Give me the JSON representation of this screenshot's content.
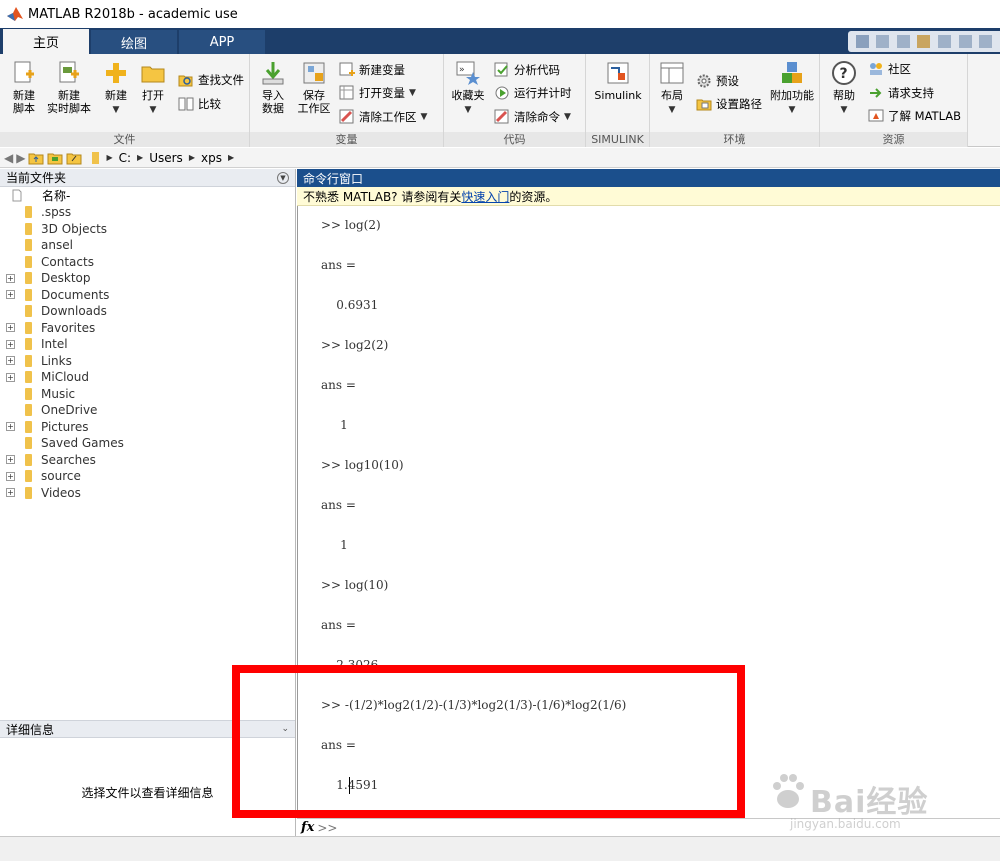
{
  "window": {
    "title": "MATLAB R2018b - academic use"
  },
  "tabs": [
    {
      "label": "主页"
    },
    {
      "label": "绘图"
    },
    {
      "label": "APP"
    }
  ],
  "ribbon": {
    "file": {
      "label": "文件",
      "new_script": "新建\n脚本",
      "new_live_script": "新建\n实时脚本",
      "new": "新建",
      "open": "打开",
      "find_files": "查找文件",
      "compare": "比较"
    },
    "variable": {
      "label": "变量",
      "import_data": "导入\n数据",
      "save_workspace": "保存\n工作区",
      "new_variable": "新建变量",
      "open_variable": "打开变量",
      "clear_workspace": "清除工作区"
    },
    "code": {
      "label": "代码",
      "favorites": "收藏夹",
      "analyze_code": "分析代码",
      "run_and_time": "运行并计时",
      "clear_commands": "清除命令"
    },
    "simulink": {
      "label": "SIMULINK",
      "simulink": "Simulink"
    },
    "environment": {
      "label": "环境",
      "layout": "布局",
      "preferences": "预设",
      "set_path": "设置路径",
      "add_ons": "附加功能"
    },
    "resources": {
      "label": "资源",
      "help": "帮助",
      "community": "社区",
      "request_support": "请求支持",
      "learn_matlab": "了解 MATLAB"
    }
  },
  "address": {
    "path": [
      "C:",
      "Users",
      "xps"
    ]
  },
  "current_folder": {
    "title": "当前文件夹",
    "column_name": "名称",
    "sort_indicator": "-",
    "items": [
      {
        "name": ".spss",
        "expandable": false
      },
      {
        "name": "3D Objects",
        "expandable": false
      },
      {
        "name": "ansel",
        "expandable": false
      },
      {
        "name": "Contacts",
        "expandable": false
      },
      {
        "name": "Desktop",
        "expandable": true
      },
      {
        "name": "Documents",
        "expandable": true
      },
      {
        "name": "Downloads",
        "expandable": false
      },
      {
        "name": "Favorites",
        "expandable": true
      },
      {
        "name": "Intel",
        "expandable": true
      },
      {
        "name": "Links",
        "expandable": true
      },
      {
        "name": "MiCloud",
        "expandable": true
      },
      {
        "name": "Music",
        "expandable": false
      },
      {
        "name": "OneDrive",
        "expandable": false
      },
      {
        "name": "Pictures",
        "expandable": true
      },
      {
        "name": "Saved Games",
        "expandable": false
      },
      {
        "name": "Searches",
        "expandable": true
      },
      {
        "name": "source",
        "expandable": true
      },
      {
        "name": "Videos",
        "expandable": true
      }
    ]
  },
  "details": {
    "title": "详细信息",
    "placeholder": "选择文件以查看详细信息"
  },
  "command_window": {
    "title": "命令行窗口",
    "notice_prefix": "不熟悉 MATLAB? 请参阅有关",
    "notice_link": "快速入门",
    "notice_suffix": "的资源。",
    "lines": [
      ">> log(2)",
      "ans =",
      "    0.6931",
      ">> log2(2)",
      "ans =",
      "     1",
      ">> log10(10)",
      "ans =",
      "     1",
      ">> log(10)",
      "ans =",
      "    2.3026",
      ">> -(1/2)*log2(1/2)-(1/3)*log2(1/3)-(1/6)*log2(1/6)",
      "ans =",
      "    1.4591"
    ],
    "prompt_fx": "fx",
    "prompt": ">>"
  },
  "watermark": {
    "text": "Bai经验",
    "sub": "jingyan.baidu.com"
  },
  "colors": {
    "tab_bar": "#1d3e6a",
    "cmd_header": "#1b4f8c",
    "highlight": "#ff0000"
  }
}
